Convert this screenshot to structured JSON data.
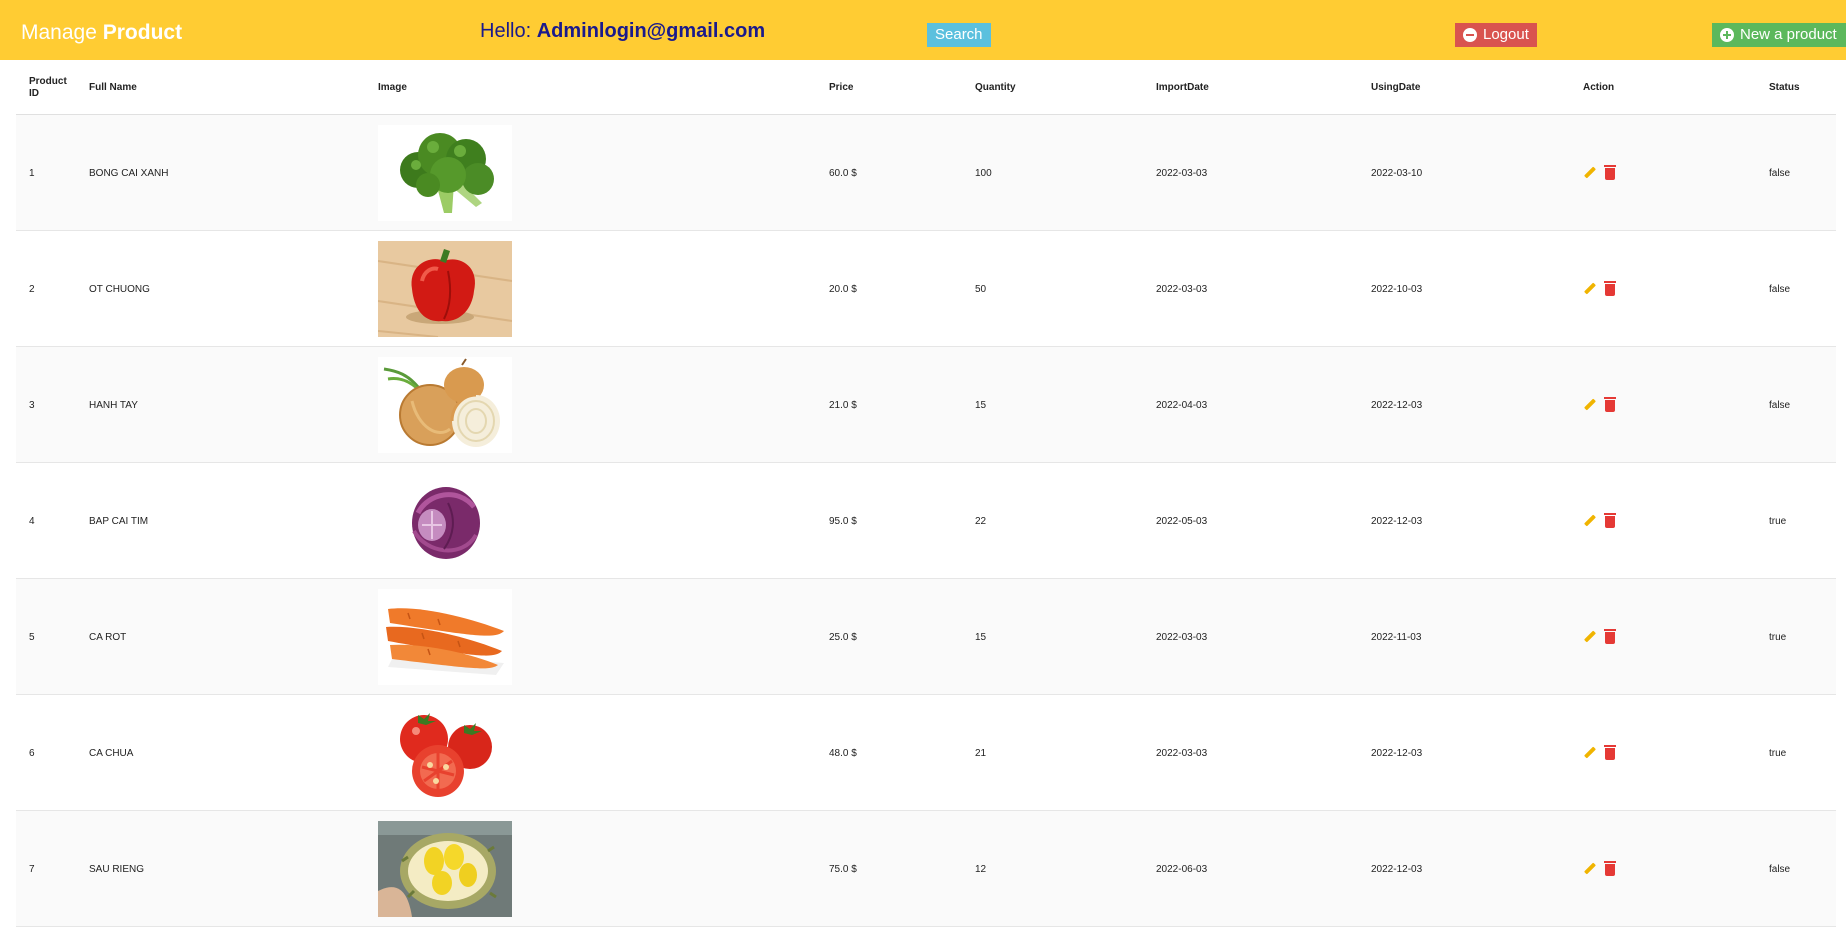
{
  "header": {
    "brand_light": "Manage",
    "brand_bold": "Product",
    "hello_prefix": "Hello:",
    "user_email": "Adminlogin@gmail.com",
    "search_label": "Search",
    "logout_label": "Logout",
    "new_label": "New a product",
    "colors": {
      "bar": "#ffcc33",
      "search": "#5bc0de",
      "logout": "#d9534f",
      "new": "#5cb85c"
    }
  },
  "columns": {
    "id_line1": "Product",
    "id_line2": "ID",
    "name": "Full Name",
    "image": "Image",
    "price": "Price",
    "quantity": "Quantity",
    "import_date": "ImportDate",
    "using_date": "UsingDate",
    "action": "Action",
    "status": "Status"
  },
  "products": [
    {
      "id": "1",
      "name": "BONG CAI XANH",
      "image": "broccoli",
      "price": "60.0 $",
      "quantity": "100",
      "import_date": "2022-03-03",
      "using_date": "2022-03-10",
      "status": "false"
    },
    {
      "id": "2",
      "name": "OT CHUONG",
      "image": "red-bell-pepper",
      "price": "20.0 $",
      "quantity": "50",
      "import_date": "2022-03-03",
      "using_date": "2022-10-03",
      "status": "false"
    },
    {
      "id": "3",
      "name": "HANH TAY",
      "image": "onion",
      "price": "21.0 $",
      "quantity": "15",
      "import_date": "2022-04-03",
      "using_date": "2022-12-03",
      "status": "false"
    },
    {
      "id": "4",
      "name": "BAP CAI TIM",
      "image": "red-cabbage",
      "price": "95.0 $",
      "quantity": "22",
      "import_date": "2022-05-03",
      "using_date": "2022-12-03",
      "status": "true"
    },
    {
      "id": "5",
      "name": "CA ROT",
      "image": "carrots",
      "price": "25.0 $",
      "quantity": "15",
      "import_date": "2022-03-03",
      "using_date": "2022-11-03",
      "status": "true"
    },
    {
      "id": "6",
      "name": "CA CHUA",
      "image": "tomatoes",
      "price": "48.0 $",
      "quantity": "21",
      "import_date": "2022-03-03",
      "using_date": "2022-12-03",
      "status": "true"
    },
    {
      "id": "7",
      "name": "SAU RIENG",
      "image": "durian",
      "price": "75.0 $",
      "quantity": "12",
      "import_date": "2022-06-03",
      "using_date": "2022-12-03",
      "status": "false"
    }
  ],
  "icons": {
    "edit": "pencil-icon",
    "delete": "trash-icon"
  }
}
